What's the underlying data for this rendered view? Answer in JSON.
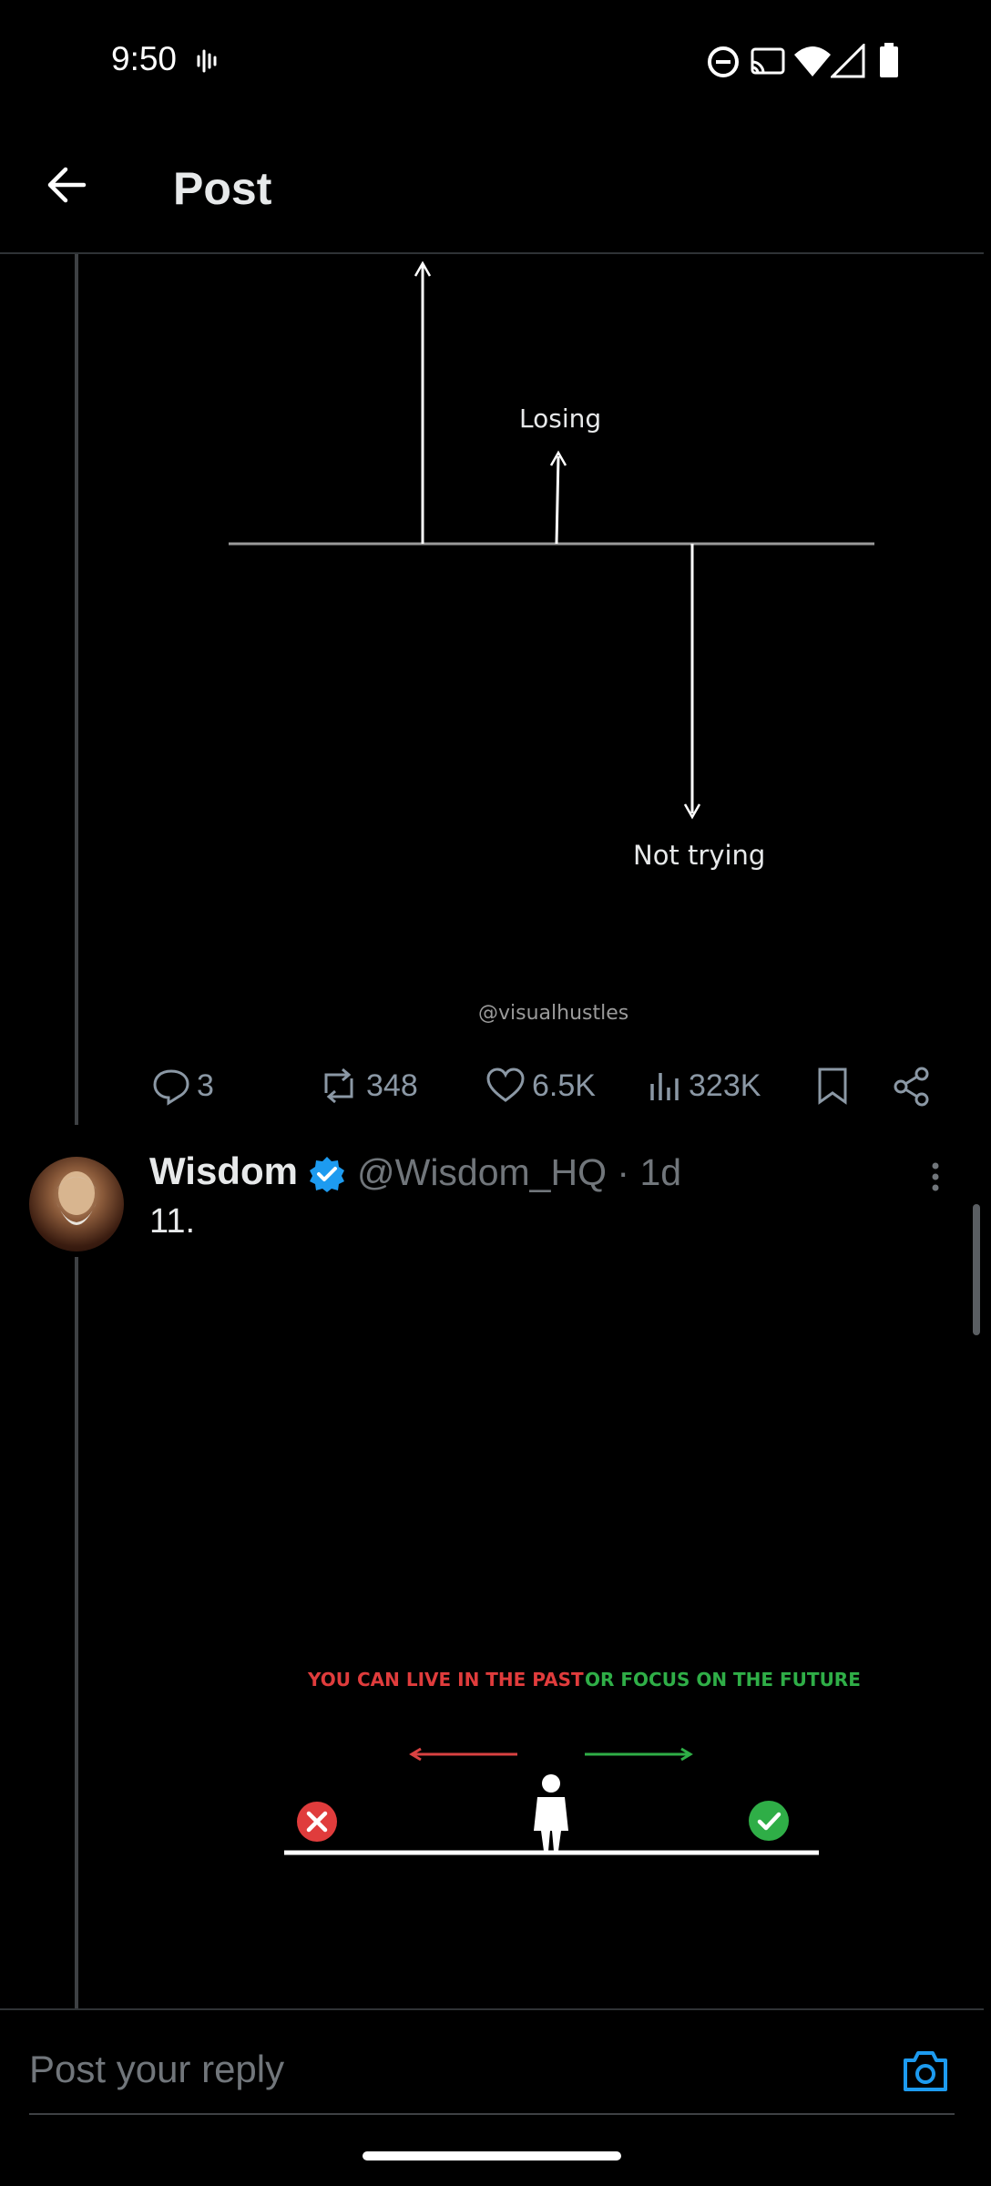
{
  "status_bar": {
    "time": "9:50"
  },
  "header": {
    "title": "Post"
  },
  "first_image": {
    "label_losing": "Losing",
    "label_not_trying": "Not trying",
    "watermark": "@visualhustles"
  },
  "actions": {
    "replies": "3",
    "reposts": "348",
    "likes": "6.5K",
    "views": "323K"
  },
  "post": {
    "author_name": "Wisdom",
    "author_handle": "@Wisdom_HQ",
    "time_ago": "1d",
    "text": "11.",
    "image_left_text": "YOU CAN LIVE IN THE PAST",
    "image_right_text": "OR FOCUS ON THE FUTURE"
  },
  "reply_bar": {
    "placeholder": "Post your reply"
  },
  "colors": {
    "accent": "#1d9bf0",
    "red": "#e03c3c",
    "green": "#2fae47"
  }
}
